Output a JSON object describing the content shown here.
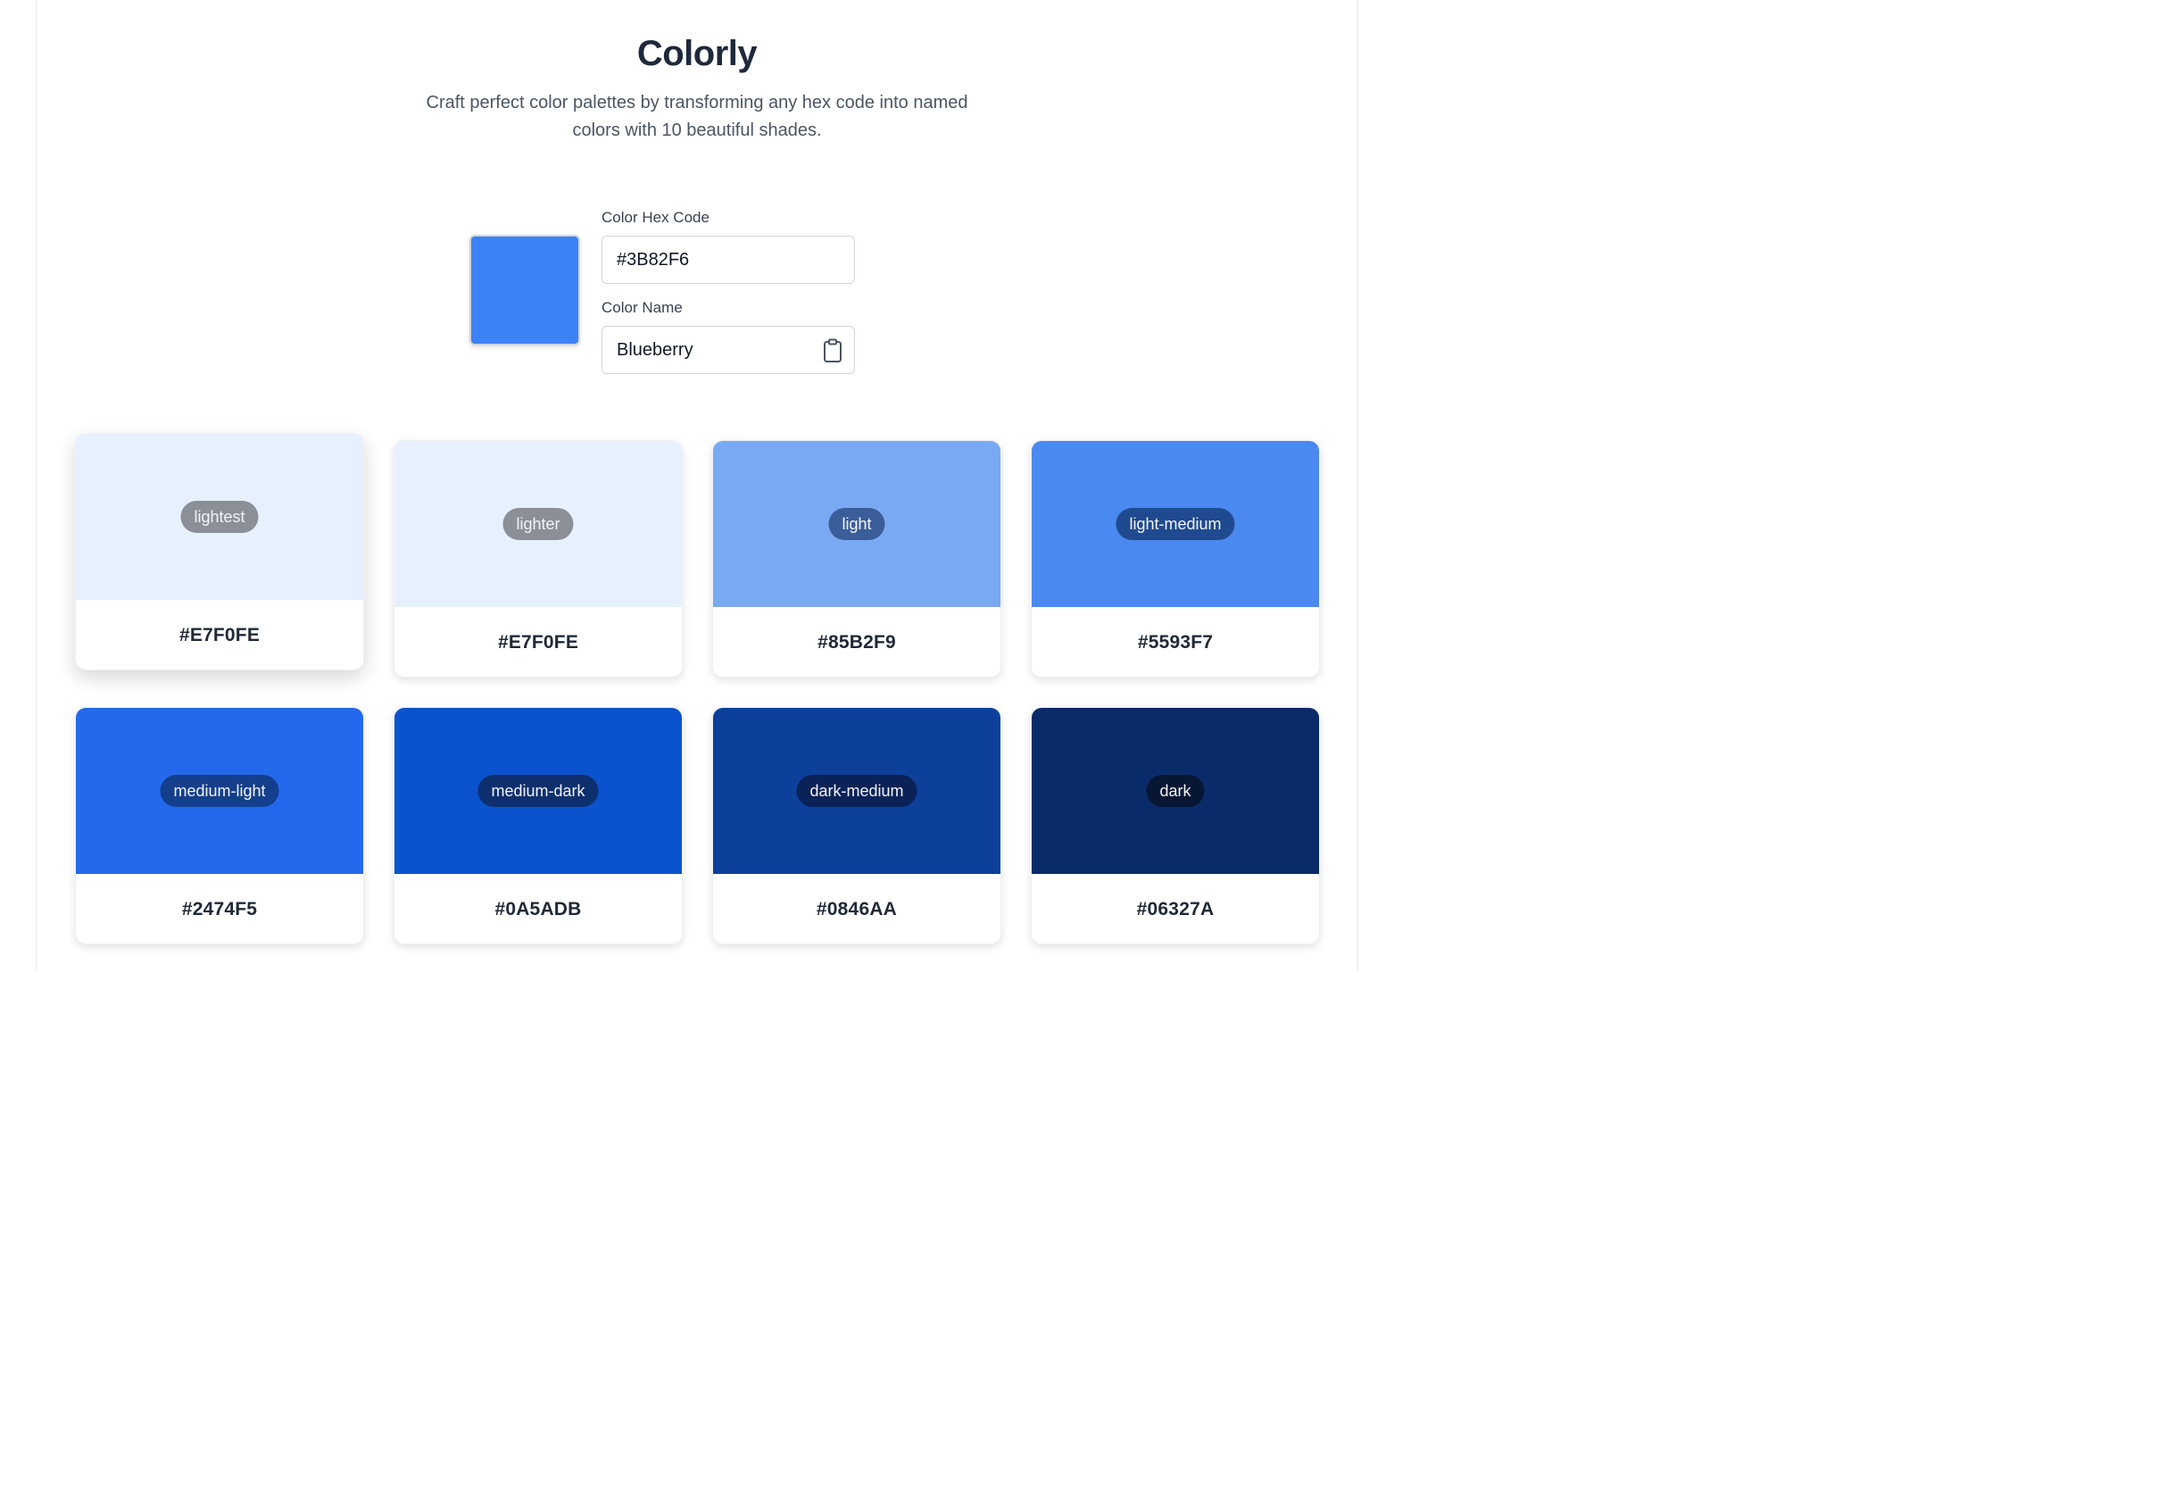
{
  "header": {
    "title": "Colorly",
    "subtitle": "Craft perfect color palettes by transforming any hex code into named colors with 10 beautiful shades."
  },
  "form": {
    "preview_color": "#3B82F6",
    "hex_label": "Color Hex Code",
    "hex_value": "#3B82F6",
    "name_label": "Color Name",
    "name_value": "Blueberry",
    "copy_icon": "clipboard-icon"
  },
  "shades": [
    {
      "label": "lightest",
      "hex": "#E7F0FE",
      "color": "#E7F0FE",
      "pill_bg": "#8a8f98"
    },
    {
      "label": "lighter",
      "hex": "#E7F0FE",
      "color": "#E7F0FE",
      "pill_bg": "#8a8f98"
    },
    {
      "label": "light",
      "hex": "#85B2F9",
      "color": "#7AA9F3",
      "pill_bg": "#3b5d9a"
    },
    {
      "label": "light-medium",
      "hex": "#5593F7",
      "color": "#4A89EF",
      "pill_bg": "#1f4a8f"
    },
    {
      "label": "medium-light",
      "hex": "#2474F5",
      "color": "#2469EC",
      "pill_bg": "#133f8c"
    },
    {
      "label": "medium-dark",
      "hex": "#0A5ADB",
      "color": "#0B52CE",
      "pill_bg": "#0d2f6e"
    },
    {
      "label": "dark-medium",
      "hex": "#0846AA",
      "color": "#0C409A",
      "pill_bg": "#0a2257"
    },
    {
      "label": "dark",
      "hex": "#06327A",
      "color": "#0A2B69",
      "pill_bg": "#071633"
    }
  ]
}
